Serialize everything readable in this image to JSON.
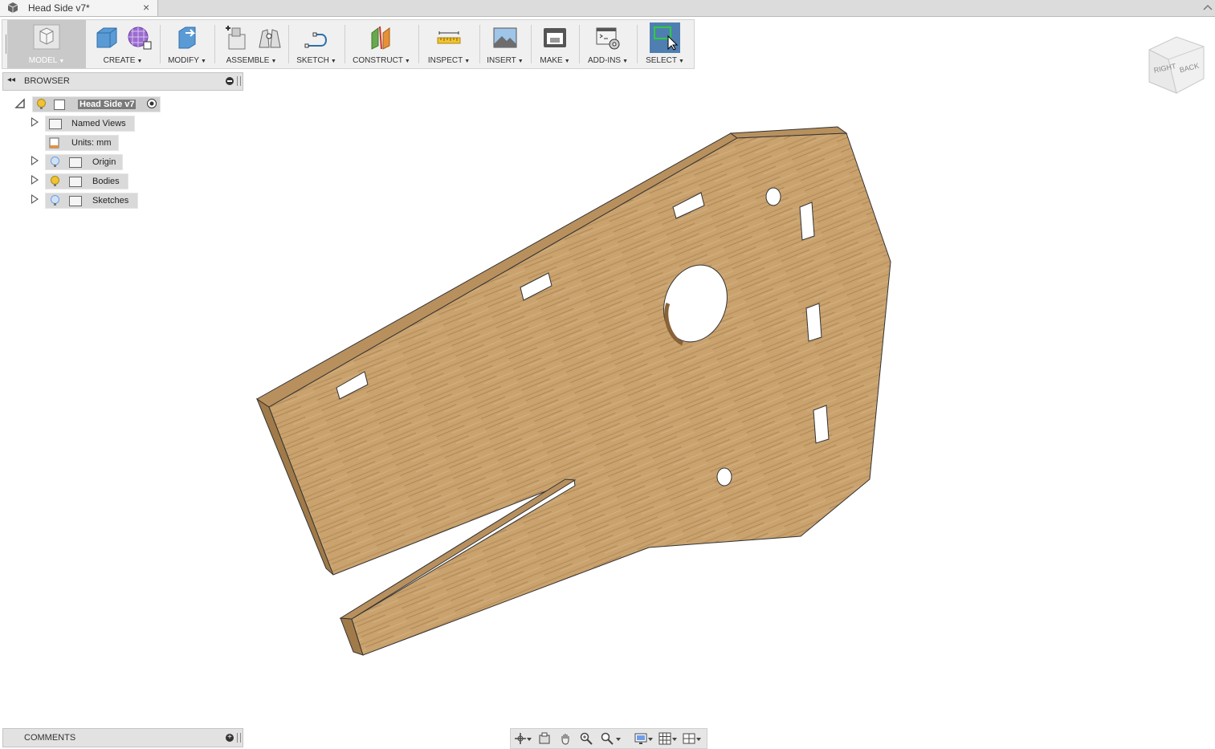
{
  "tab": {
    "title": "Head Side v7*",
    "close": "×"
  },
  "toolbar": {
    "model": "MODEL",
    "create": "CREATE",
    "modify": "MODIFY",
    "assemble": "ASSEMBLE",
    "sketch": "SKETCH",
    "construct": "CONSTRUCT",
    "inspect": "INSPECT",
    "insert": "INSERT",
    "make": "MAKE",
    "addins": "ADD-INS",
    "select": "SELECT",
    "caret": "▼"
  },
  "browser": {
    "title": "BROWSER",
    "root": "Head Side v7",
    "items": [
      {
        "label": "Named Views"
      },
      {
        "label": "Units: mm"
      },
      {
        "label": "Origin"
      },
      {
        "label": "Bodies"
      },
      {
        "label": "Sketches"
      }
    ]
  },
  "comments": {
    "title": "COMMENTS"
  },
  "viewcube": {
    "right": "RIGHT",
    "back": "BACK"
  },
  "colors": {
    "accent": "#4f7fb0",
    "wood": "#c9a06a",
    "wood_edge": "#a07a48"
  }
}
